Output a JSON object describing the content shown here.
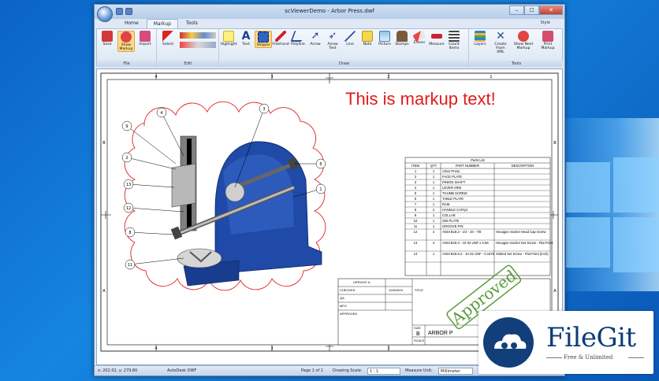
{
  "window": {
    "title": "scViewerDemo - Arbor Press.dwf",
    "close": "✕",
    "minimize": "–",
    "maximize": "☐"
  },
  "tabs": [
    {
      "label": "Home"
    },
    {
      "label": "Markup"
    },
    {
      "label": "Tools"
    }
  ],
  "style_label": "Style",
  "ribbon": {
    "file_group": {
      "label": "File",
      "buttons": [
        "Save",
        "Show Markup",
        "Import"
      ]
    },
    "edit_group": {
      "label": "Edit",
      "buttons": [
        "Select"
      ]
    },
    "draw_group": {
      "label": "Draw",
      "buttons": [
        "Highlight",
        "Text",
        "Shapes",
        "Freehand",
        "Polyline",
        "Arrow",
        "Arrow Text",
        "Line",
        "Note",
        "Picture",
        "Stamps",
        "Eraser",
        "Measure",
        "Count Items"
      ]
    },
    "tools_group": {
      "label": "Tools",
      "buttons": [
        "Layers",
        "Create From XML",
        "Show Next Markup",
        "Print Markup"
      ]
    }
  },
  "drawing": {
    "markup_text": "This is markup text!",
    "stamp_text": "Approved",
    "col_numbers": [
      "4",
      "3",
      "2",
      "1"
    ],
    "row_letters": [
      "B",
      "A"
    ],
    "parts_list_title": "Parts List",
    "parts_headers": [
      "ITEM",
      "QTY",
      "PART NUMBER",
      "DESCRIPTION"
    ],
    "parts_rows": [
      [
        "1",
        "1",
        "Arbor Press",
        ""
      ],
      [
        "2",
        "1",
        "FACE PLATE",
        ""
      ],
      [
        "3",
        "1",
        "PINION SHAFT",
        ""
      ],
      [
        "4",
        "1",
        "LEVER ARM",
        ""
      ],
      [
        "5",
        "1",
        "THUMB SCREW",
        ""
      ],
      [
        "6",
        "1",
        "TABLE PLATE",
        ""
      ],
      [
        "7",
        "1",
        "RAM",
        ""
      ],
      [
        "8",
        "2",
        "HANDLE CAP.ipt",
        ""
      ],
      [
        "9",
        "1",
        "COLLAR",
        ""
      ],
      [
        "10",
        "1",
        "GIB PLATE",
        ""
      ],
      [
        "11",
        "1",
        "GROOVE PIN",
        ""
      ],
      [
        "12",
        "4",
        "ANSI B18.3 - 1/4 - 20 - 7/8",
        "Hexagon Socket Head Cap Screw"
      ],
      [
        "13",
        "4",
        "ANSI B18.3 - 10-32 UNF x 0.56",
        "Hexagon Socket Set Screw - Flat Point"
      ],
      [
        "14",
        "1",
        "ANSI B18.6.2 - 10-32 UNF - 0.1875",
        "Slotted Set Screw - Flat Point (Inch)"
      ]
    ],
    "title_block": {
      "drawn": "UPRIGHT A",
      "date": "12/8/2003",
      "checked": "CHECKED",
      "qa": "QA",
      "mfg": "MFG",
      "approved": "APPROVED",
      "title": "TITLE",
      "size_label": "SIZE",
      "size": "B",
      "scale": "SCALE",
      "dwg": "ARBOR P"
    },
    "balloons": [
      "4",
      "9",
      "2",
      "13",
      "12",
      "8",
      "11",
      "3",
      "6",
      "1"
    ]
  },
  "status": {
    "coords": "x: 202.02, y: 279.80",
    "source": "AutoDesk DWF",
    "page": "Page 1 of 1",
    "drawing_scale_label": "Drawing Scale:",
    "drawing_scale": "1 : 1",
    "measure_unit_label": "Measure Unit:",
    "measure_unit": "Millimeter"
  },
  "filegit": {
    "name": "FileGit",
    "tagline": "Free & Unlimited"
  },
  "colors": {
    "markup_red": "#e31b1b",
    "stamp_green": "#5a9a3a",
    "press_blue": "#1f4aa8",
    "cloud_red": "#e02020",
    "ribbon_sel": "#ffd98a"
  }
}
